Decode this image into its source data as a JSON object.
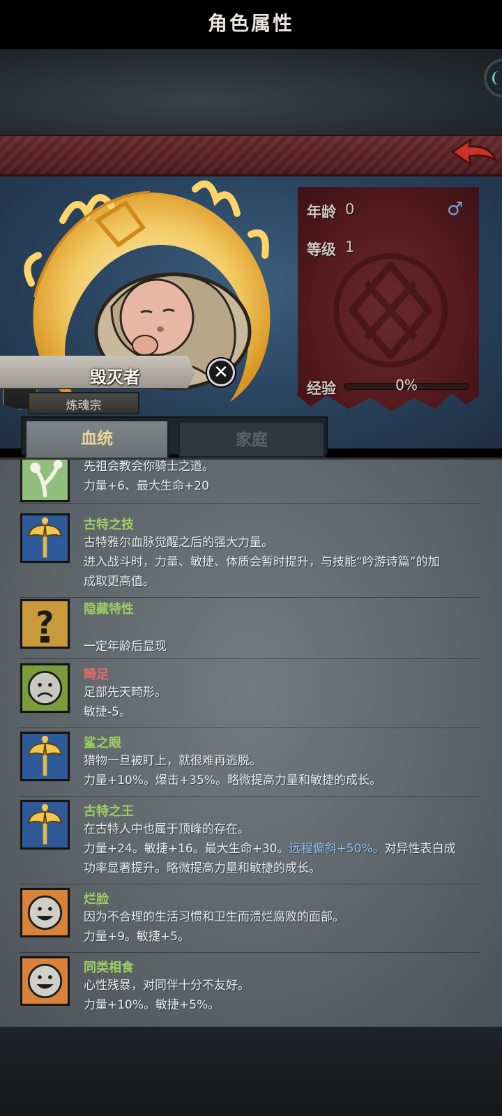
{
  "header": {
    "title": "角色属性",
    "back_icon": "back-arrow-icon",
    "back_color": "#c8322b"
  },
  "character": {
    "name": "毁灭者",
    "sect": "炼魂宗"
  },
  "stats": {
    "age_label": "年龄",
    "age_value": "0",
    "level_label": "等级",
    "level_value": "1",
    "exp_label": "经验",
    "exp_value": "0%",
    "exp_fraction": 0.0,
    "gender_icon": "male-icon"
  },
  "tabs": [
    {
      "label": "血统",
      "active": true
    },
    {
      "label": "家庭",
      "active": false
    }
  ],
  "traits": [
    {
      "name": "",
      "icon": "sprout-icon",
      "lines": [
        "先祖会教会你骑士之道。",
        "力量+6、最大生命+20"
      ],
      "color": "green"
    },
    {
      "name": "古特之技",
      "icon": "axe-icon",
      "lines": [
        "古特雅尔血脉觉醒之后的强大力量。",
        "进入战斗时，力量、敏捷、体质会暂时提升，与技能“吟游诗篇”的加",
        "成取更高值。"
      ],
      "color": "green"
    },
    {
      "name": "隐藏特性",
      "icon": "question-icon",
      "lines": [
        "",
        "一定年龄后显现"
      ],
      "color": "green"
    },
    {
      "name": "畸足",
      "icon": "sad-face-icon",
      "lines": [
        "足部先天畸形。",
        "敏捷-5。"
      ],
      "color": "red"
    },
    {
      "name": "鲨之眼",
      "icon": "axe-icon",
      "lines": [
        "猎物一旦被盯上，就很难再逃脱。",
        "力量+10%。爆击+35%。略微提高力量和敏捷的成长。"
      ],
      "color": "green"
    },
    {
      "name": "古特之王",
      "icon": "axe-icon",
      "lines": [
        "在古特人中也属于顶峰的存在。",
        "力量+24。敏捷+16。最大生命+30。",
        "功率显著提升。略微提高力量和敏捷的成长。"
      ],
      "extra": "远程偏斜+50%。",
      "extra_tail": "对异性表白成",
      "color": "green"
    },
    {
      "name": "烂脸",
      "icon": "smile-face-icon",
      "lines": [
        "因为不合理的生活习惯和卫生而溃烂腐败的面部。",
        "力量+9。敏捷+5。"
      ],
      "color": "green"
    },
    {
      "name": "同类相食",
      "icon": "smile-face-icon",
      "lines": [
        "心性残暴，对同伴十分不友好。",
        "力量+10%。敏捷+5%。"
      ],
      "color": "green"
    }
  ]
}
